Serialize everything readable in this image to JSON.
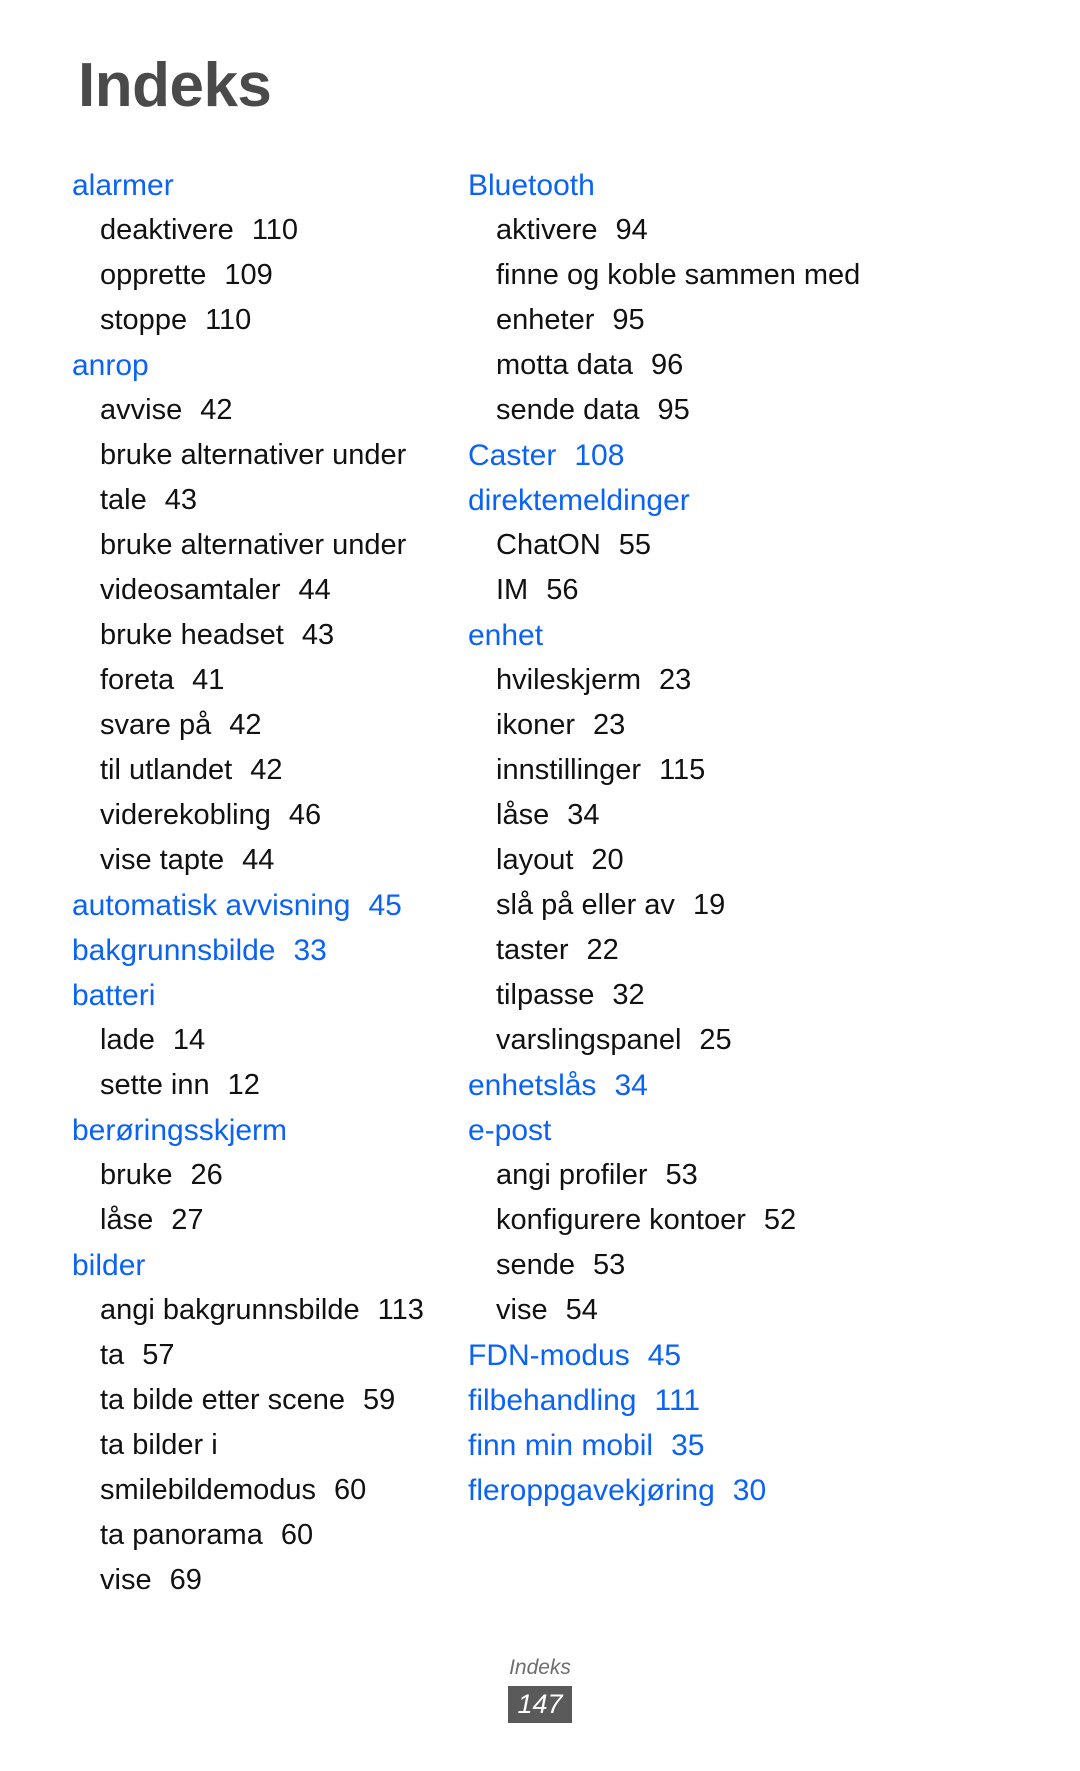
{
  "document": {
    "title": "Indeks",
    "footer_label": "Indeks",
    "footer_page": "147",
    "accent_color": "#0a63f5",
    "title_color": "#4a4a4a",
    "body_color": "#111111",
    "badge_color": "#5a5a5a"
  },
  "columns": [
    {
      "name": "left",
      "groups": [
        {
          "heading": "alarmer",
          "page": "",
          "subentries": [
            {
              "label": "deaktivere",
              "page": "110"
            },
            {
              "label": "opprette",
              "page": "109"
            },
            {
              "label": "stoppe",
              "page": "110"
            }
          ]
        },
        {
          "heading": "anrop",
          "page": "",
          "subentries": [
            {
              "label": "avvise",
              "page": "42"
            },
            {
              "label": "bruke alternativer under",
              "page": ""
            },
            {
              "label": "tale",
              "page": "43"
            },
            {
              "label": "bruke alternativer under",
              "page": ""
            },
            {
              "label": "videosamtaler",
              "page": "44"
            },
            {
              "label": "bruke headset",
              "page": "43"
            },
            {
              "label": "foreta",
              "page": "41"
            },
            {
              "label": "svare på",
              "page": "42"
            },
            {
              "label": "til utlandet",
              "page": "42"
            },
            {
              "label": "viderekobling",
              "page": "46"
            },
            {
              "label": "vise tapte",
              "page": "44"
            }
          ]
        },
        {
          "heading": "automatisk avvisning",
          "page": "45",
          "subentries": []
        },
        {
          "heading": "bakgrunnsbilde",
          "page": "33",
          "subentries": []
        },
        {
          "heading": "batteri",
          "page": "",
          "subentries": [
            {
              "label": "lade",
              "page": "14"
            },
            {
              "label": "sette inn",
              "page": "12"
            }
          ]
        },
        {
          "heading": "berøringsskjerm",
          "page": "",
          "subentries": [
            {
              "label": "bruke",
              "page": "26"
            },
            {
              "label": "låse",
              "page": "27"
            }
          ]
        },
        {
          "heading": "bilder",
          "page": "",
          "subentries": [
            {
              "label": "angi bakgrunnsbilde",
              "page": "113"
            },
            {
              "label": "ta",
              "page": "57"
            },
            {
              "label": "ta bilde etter scene",
              "page": "59"
            },
            {
              "label": "ta bilder i",
              "page": ""
            },
            {
              "label": "smilebildemodus",
              "page": "60"
            },
            {
              "label": "ta panorama",
              "page": "60"
            },
            {
              "label": "vise",
              "page": "69"
            }
          ]
        }
      ]
    },
    {
      "name": "right",
      "groups": [
        {
          "heading": "Bluetooth",
          "page": "",
          "subentries": [
            {
              "label": "aktivere",
              "page": "94"
            },
            {
              "label": "finne og koble sammen med",
              "page": ""
            },
            {
              "label": "enheter",
              "page": "95"
            },
            {
              "label": "motta data",
              "page": "96"
            },
            {
              "label": "sende data",
              "page": "95"
            }
          ]
        },
        {
          "heading": "Caster",
          "page": "108",
          "subentries": []
        },
        {
          "heading": "direktemeldinger",
          "page": "",
          "subentries": [
            {
              "label": "ChatON",
              "page": "55"
            },
            {
              "label": "IM",
              "page": "56"
            }
          ]
        },
        {
          "heading": "enhet",
          "page": "",
          "subentries": [
            {
              "label": "hvileskjerm",
              "page": "23"
            },
            {
              "label": "ikoner",
              "page": "23"
            },
            {
              "label": "innstillinger",
              "page": "115"
            },
            {
              "label": "låse",
              "page": "34"
            },
            {
              "label": "layout",
              "page": "20"
            },
            {
              "label": "slå på eller av",
              "page": "19"
            },
            {
              "label": "taster",
              "page": "22"
            },
            {
              "label": "tilpasse",
              "page": "32"
            },
            {
              "label": "varslingspanel",
              "page": "25"
            }
          ]
        },
        {
          "heading": "enhetslås",
          "page": "34",
          "subentries": []
        },
        {
          "heading": "e-post",
          "page": "",
          "subentries": [
            {
              "label": "angi profiler",
              "page": "53"
            },
            {
              "label": "konfigurere kontoer",
              "page": "52"
            },
            {
              "label": "sende",
              "page": "53"
            },
            {
              "label": "vise",
              "page": "54"
            }
          ]
        },
        {
          "heading": "FDN-modus",
          "page": "45",
          "subentries": []
        },
        {
          "heading": "filbehandling",
          "page": "111",
          "subentries": []
        },
        {
          "heading": "finn min mobil",
          "page": "35",
          "subentries": []
        },
        {
          "heading": "fleroppgavekjøring",
          "page": "30",
          "subentries": []
        }
      ]
    }
  ]
}
